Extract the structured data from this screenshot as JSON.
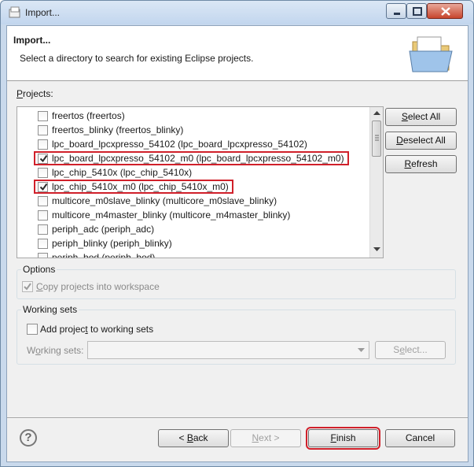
{
  "window": {
    "title": "Import..."
  },
  "banner": {
    "heading": "Import...",
    "description": "Select a directory to search for existing Eclipse projects."
  },
  "projects": {
    "label_pre": "",
    "label_u": "P",
    "label_post": "rojects:",
    "items": [
      {
        "label": "freertos (freertos)",
        "checked": false,
        "highlight": false
      },
      {
        "label": "freertos_blinky (freertos_blinky)",
        "checked": false,
        "highlight": false
      },
      {
        "label": "lpc_board_lpcxpresso_54102 (lpc_board_lpcxpresso_54102)",
        "checked": false,
        "highlight": false
      },
      {
        "label": "lpc_board_lpcxpresso_54102_m0 (lpc_board_lpcxpresso_54102_m0)",
        "checked": true,
        "highlight": true
      },
      {
        "label": "lpc_chip_5410x (lpc_chip_5410x)",
        "checked": false,
        "highlight": false
      },
      {
        "label": "lpc_chip_5410x_m0 (lpc_chip_5410x_m0)",
        "checked": true,
        "highlight": true
      },
      {
        "label": "multicore_m0slave_blinky (multicore_m0slave_blinky)",
        "checked": false,
        "highlight": false
      },
      {
        "label": "multicore_m4master_blinky (multicore_m4master_blinky)",
        "checked": false,
        "highlight": false
      },
      {
        "label": "periph_adc (periph_adc)",
        "checked": false,
        "highlight": false
      },
      {
        "label": "periph_blinky (periph_blinky)",
        "checked": false,
        "highlight": false
      },
      {
        "label": "periph_bod (periph_bod)",
        "checked": false,
        "highlight": false
      }
    ]
  },
  "side_buttons": {
    "select_all_u": "S",
    "select_all_rest": "elect All",
    "deselect_all_u": "D",
    "deselect_all_rest": "eselect All",
    "refresh_u": "R",
    "refresh_rest": "efresh"
  },
  "options": {
    "title": "Options",
    "copy_pre": "",
    "copy_u": "C",
    "copy_post": "opy projects into workspace",
    "copy_checked": true
  },
  "working_sets": {
    "title": "Working sets",
    "add_pre": "Add projec",
    "add_u": "t",
    "add_post": " to working sets",
    "add_checked": false,
    "ws_label_pre": "W",
    "ws_label_u": "o",
    "ws_label_post": "rking sets:",
    "ws_value": "",
    "select_u": "e",
    "select_pre": "S",
    "select_post": "lect..."
  },
  "footer": {
    "help_glyph": "?",
    "back_pre": "< ",
    "back_u": "B",
    "back_post": "ack",
    "next_pre": "",
    "next_u": "N",
    "next_post": "ext >",
    "finish_u": "F",
    "finish_post": "inish",
    "cancel": "Cancel"
  },
  "colors": {
    "highlight": "#d0202a",
    "titlebar": "#c2d6ee",
    "dialog_bg": "#f0f0f0"
  }
}
